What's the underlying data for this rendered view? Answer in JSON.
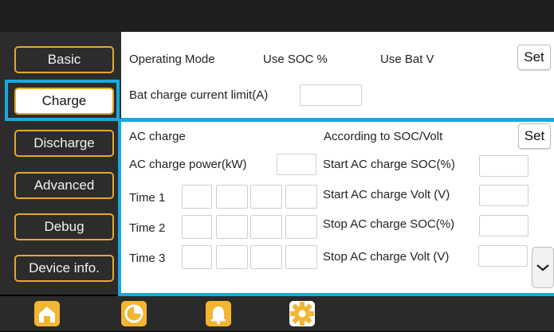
{
  "sidebar": {
    "items": [
      {
        "label": "Basic"
      },
      {
        "label": "Charge"
      },
      {
        "label": "Discharge"
      },
      {
        "label": "Advanced"
      },
      {
        "label": "Debug"
      },
      {
        "label": "Device info."
      }
    ],
    "active_index": 1
  },
  "top_panel": {
    "operating_mode_label": "Operating Mode",
    "use_soc_label": "Use SOC %",
    "use_bat_v_label": "Use Bat V",
    "set_label": "Set",
    "bat_charge_current_limit_label": "Bat charge current limit(A)",
    "bat_charge_current_limit_value": ""
  },
  "ac_panel": {
    "ac_charge_label": "AC charge",
    "according_label": "According to SOC/Volt",
    "set_label": "Set",
    "ac_charge_power_label": "AC charge power(kW)",
    "ac_charge_power_value": "",
    "times": [
      {
        "label": "Time  1"
      },
      {
        "label": "Time  2"
      },
      {
        "label": "Time  3"
      }
    ],
    "start_soc_label": "Start AC charge SOC(%)",
    "start_volt_label": "Start AC charge Volt (V)",
    "stop_soc_label": "Stop AC charge SOC(%)",
    "stop_volt_label": "Stop AC charge Volt (V)"
  },
  "bottom_nav": {
    "icons": [
      "home-icon",
      "pie-chart-icon",
      "bell-icon",
      "gear-icon"
    ],
    "active_icon": "gear-icon"
  },
  "colors": {
    "accent": "#e2a92c",
    "highlight": "#18a9e0"
  }
}
